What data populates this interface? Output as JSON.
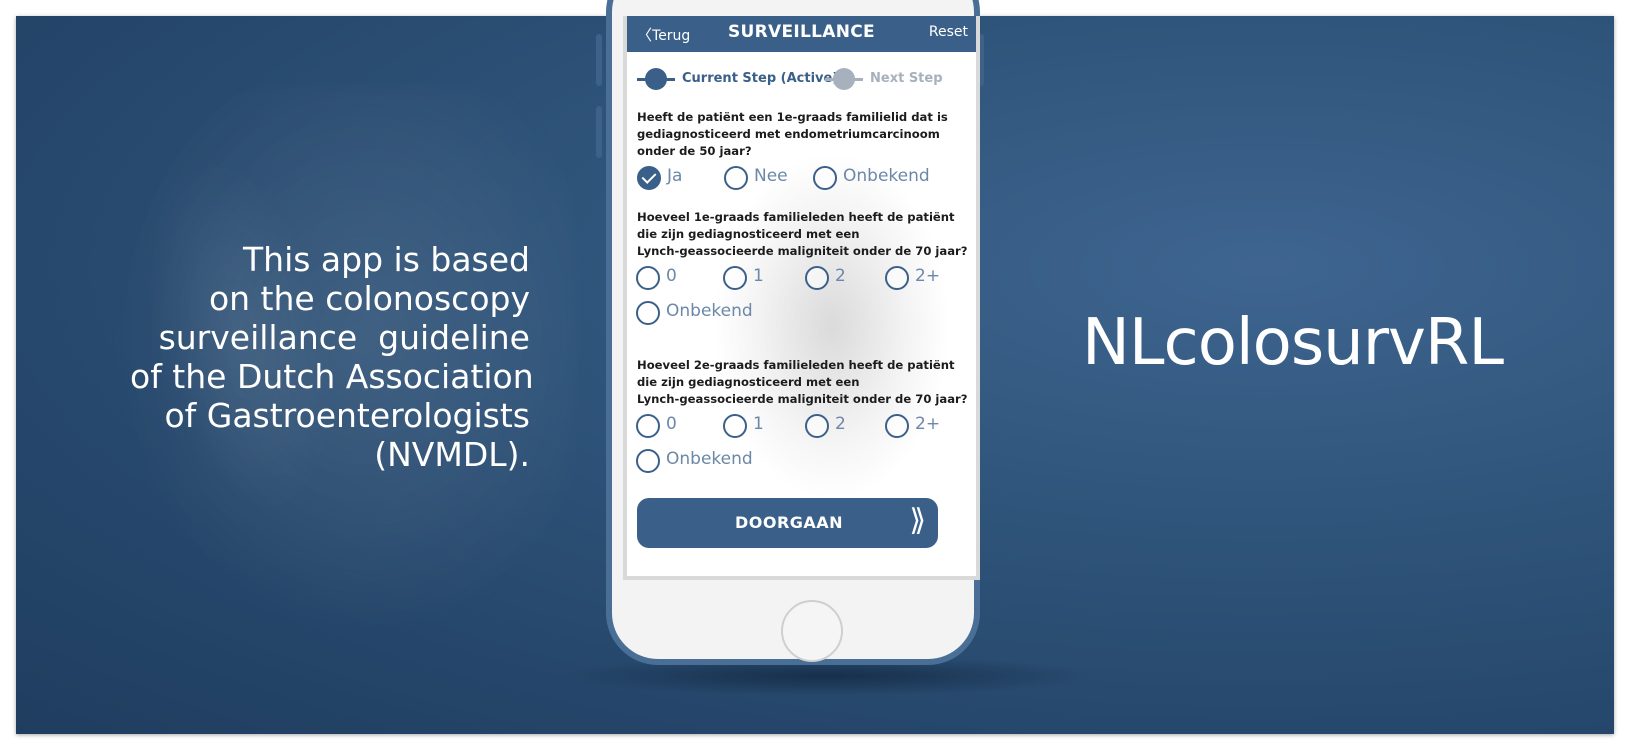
{
  "left_text_lines": [
    "This app is based",
    "on the colonoscopy",
    "surveillance  guideline",
    "of the Dutch Association",
    "of Gastroenterologists",
    "(NVMDL)."
  ],
  "brand": "NLcolosurvRL",
  "app": {
    "nav": {
      "back_label": "Terug",
      "title": "SURVEILLANCE",
      "reset_label": "Reset"
    },
    "steps": {
      "current_label": "Current Step (Active)",
      "next_label": "Next Step",
      "current_color": "#3a6089",
      "next_color": "#a7b1bd"
    },
    "q1": {
      "lines": [
        "Heeft de patiënt een 1e-graads familielid dat is",
        "gediagnosticeerd met endometriumcarcinoom",
        "onder de 50 jaar?"
      ],
      "options": [
        "Ja",
        "Nee",
        "Onbekend"
      ],
      "selected": "Ja"
    },
    "q2": {
      "lines": [
        "Hoeveel 1e-graads familieleden heeft de patiënt",
        "die zijn gediagnosticeerd met een",
        "Lynch-geassocieerde maligniteit onder de 70 jaar?"
      ],
      "options": [
        "0",
        "1",
        "2",
        "2+",
        "Onbekend"
      ]
    },
    "q3": {
      "lines": [
        "Hoeveel 2e-graads familieleden heeft de patiënt",
        "die zijn gediagnosticeerd met een",
        "Lynch-geassocieerde maligniteit onder de 70 jaar?"
      ],
      "options": [
        "0",
        "1",
        "2",
        "2+",
        "Onbekend"
      ]
    },
    "continue_label": "DOORGAAN",
    "continue_icon": "double-chevron-right",
    "back_icon": "chevron-left"
  },
  "colors": {
    "accent": "#3a6089",
    "background": "#2b4f76"
  }
}
